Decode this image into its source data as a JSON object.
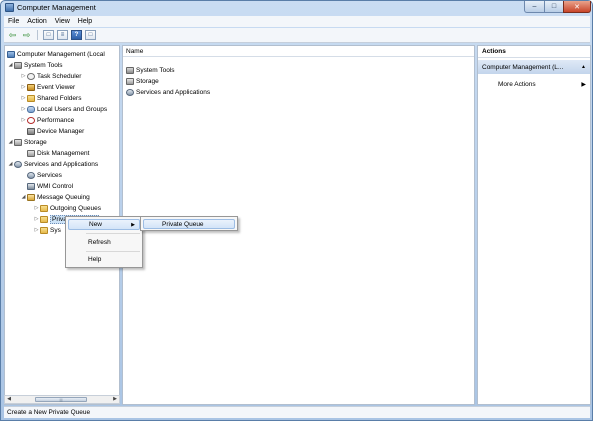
{
  "window": {
    "title": "Computer Management",
    "min_glyph": "–",
    "max_glyph": "□",
    "close_glyph": "✕"
  },
  "menubar": {
    "items": [
      "File",
      "Action",
      "View",
      "Help"
    ]
  },
  "toolbar": {
    "back_glyph": "⇦",
    "forward_glyph": "⇨",
    "help_glyph": "?"
  },
  "tree": {
    "items": [
      "Computer Management (Local",
      "System Tools",
      "Task Scheduler",
      "Event Viewer",
      "Shared Folders",
      "Local Users and Groups",
      "Performance",
      "Device Manager",
      "Storage",
      "Disk Management",
      "Services and Applications",
      "Services",
      "WMI Control",
      "Message Queuing",
      "Outgoing Queues",
      "Private Queues",
      "Sys"
    ],
    "scroll_glyphs": [
      "◀",
      "▶"
    ]
  },
  "center": {
    "column_header": "Name",
    "rows": [
      "System Tools",
      "Storage",
      "Services and Applications"
    ]
  },
  "actions": {
    "header": "Actions",
    "section": "Computer Management (L...",
    "more_actions": "More Actions"
  },
  "context_menu": {
    "items": [
      "New",
      "Refresh",
      "Help"
    ],
    "highlighted": "New"
  },
  "submenu": {
    "items": [
      "Private Queue"
    ]
  },
  "status": {
    "text": "Create a New Private Queue"
  },
  "colors": {
    "title_gradient": [
      "#c9dcf2",
      "#a9c4e4"
    ],
    "selection": "#cde3f7",
    "close_button": "#c8452a"
  }
}
